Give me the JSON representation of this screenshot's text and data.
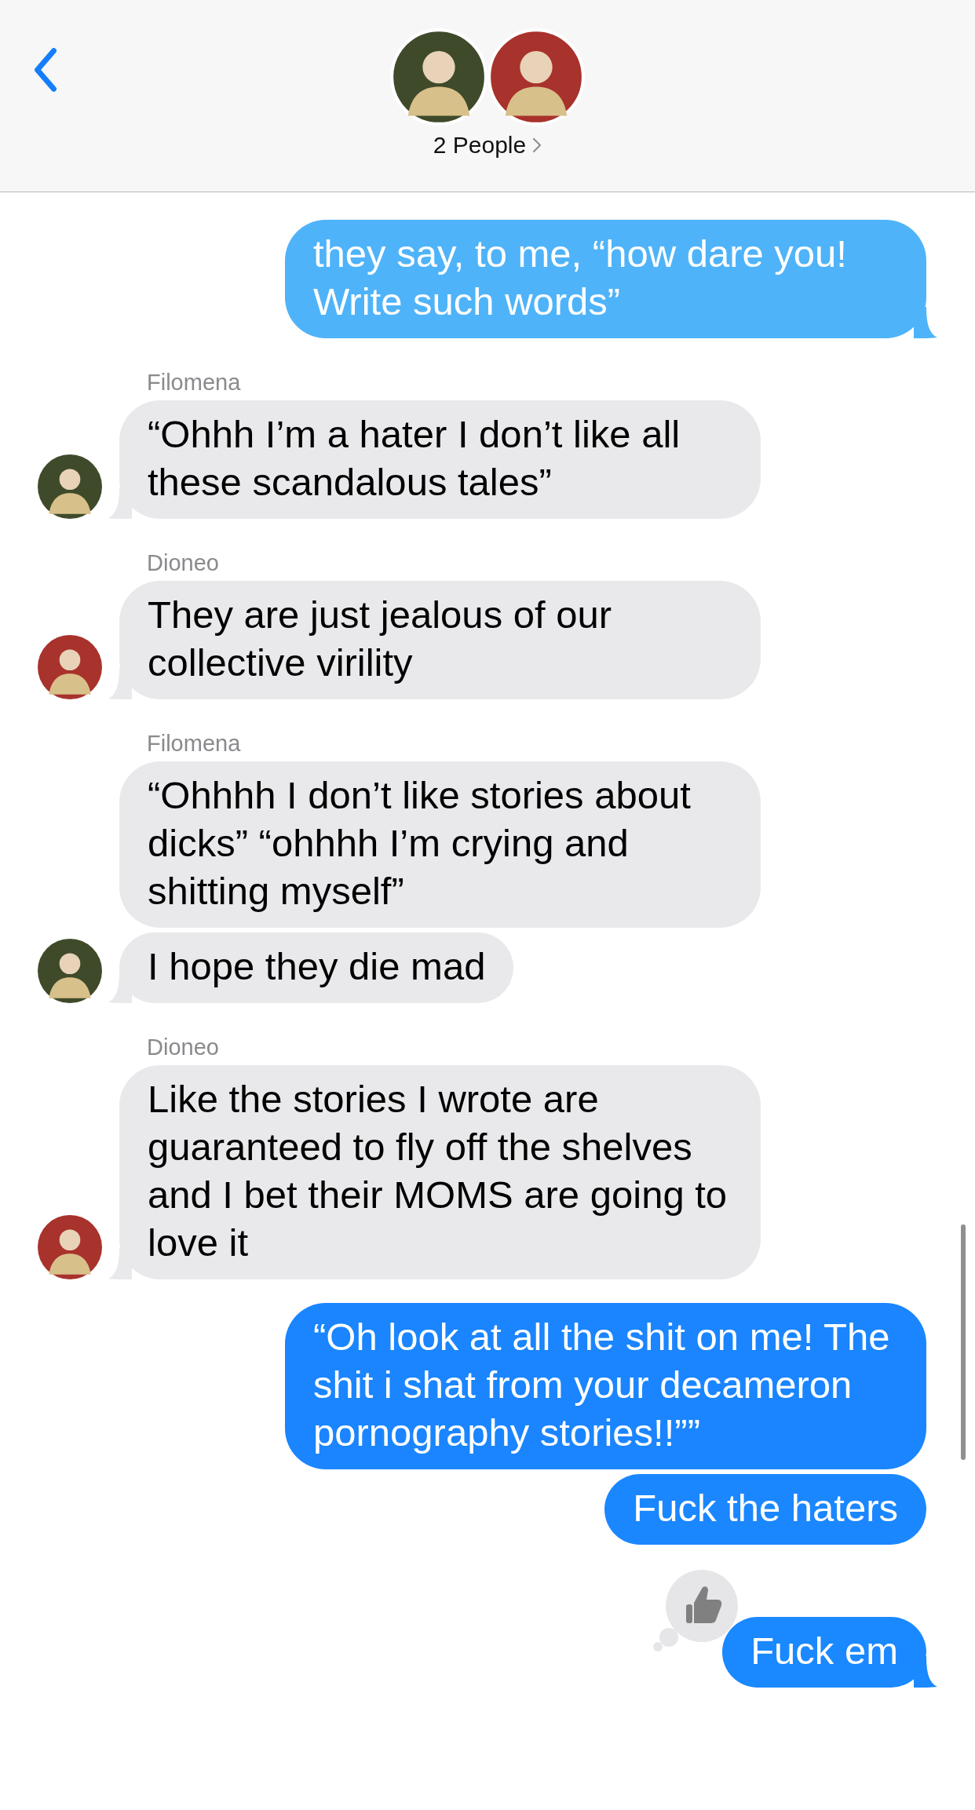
{
  "header": {
    "title": "2 People",
    "avatars": [
      {
        "color": "#3f4a2a"
      },
      {
        "color": "#a8322c"
      }
    ]
  },
  "messages": [
    {
      "kind": "sent",
      "color": "#4fb3f9",
      "text": "they say, to me, “how dare you! Write such words”"
    },
    {
      "kind": "received",
      "sender": "Filomena",
      "color": "#3f4a2a",
      "text": "“Ohhh I’m a hater I don’t like all these scandalous tales”"
    },
    {
      "kind": "received",
      "sender": "Dioneo",
      "color": "#a8322c",
      "text": "They are just jealous of our collective virility"
    },
    {
      "kind": "received",
      "sender": "Filomena",
      "text": "“Ohhhh I don’t like stories about dicks” “ohhhh I’m crying and shitting myself”"
    },
    {
      "kind": "received",
      "color": "#3f4a2a",
      "text": "I hope they die mad"
    },
    {
      "kind": "received",
      "sender": "Dioneo",
      "color": "#a8322c",
      "text": "Like the stories I wrote are guaranteed to fly off the shelves and I bet their MOMS are going to love it"
    },
    {
      "kind": "sent",
      "color": "#1a85fe",
      "text": "“Oh look at all the shit on me! The shit i shat from your decameron pornography stories!!””"
    },
    {
      "kind": "sent",
      "color": "#1a87ff",
      "text": "Fuck the haters"
    },
    {
      "kind": "sent",
      "color": "#1a88ff",
      "text": "Fuck em",
      "reaction": {
        "kind": "like"
      }
    }
  ]
}
